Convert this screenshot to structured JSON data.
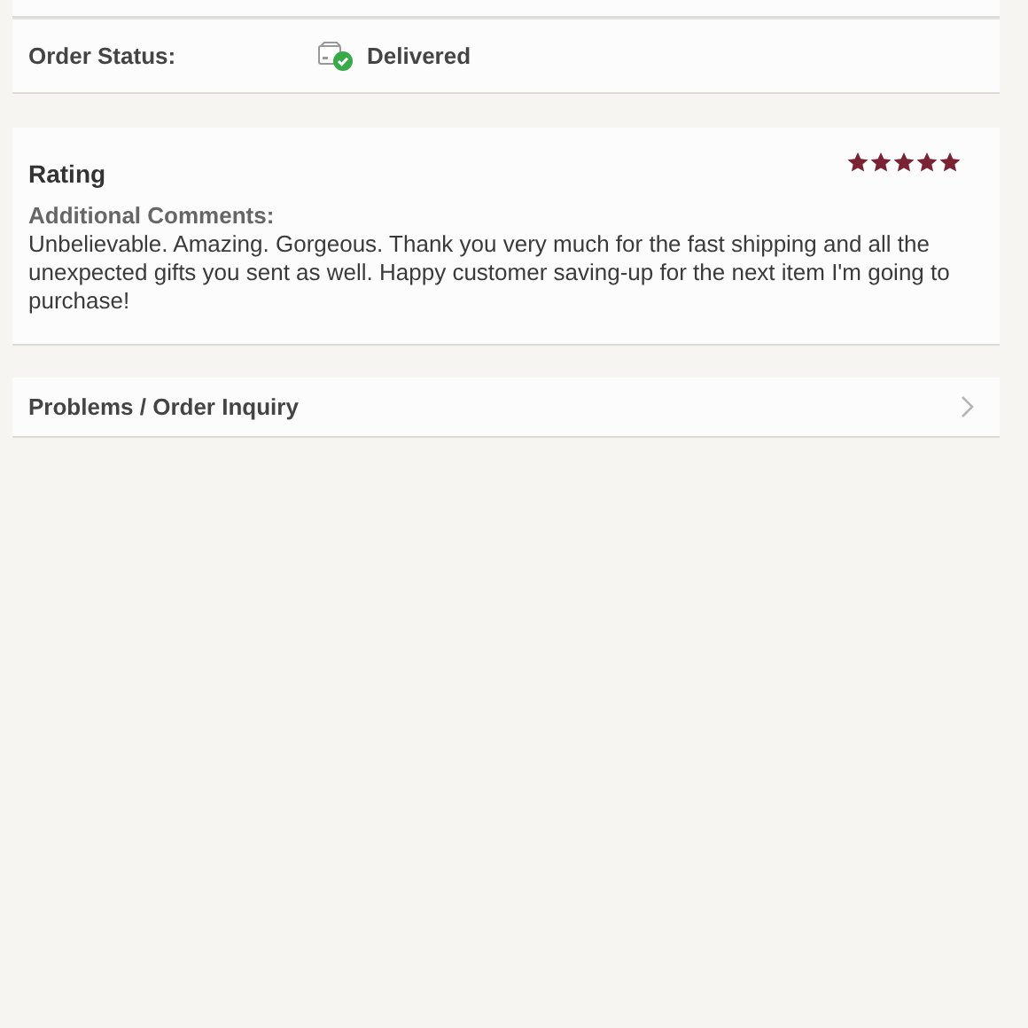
{
  "order_status": {
    "label": "Order Status:",
    "value": "Delivered"
  },
  "rating": {
    "title": "Rating",
    "stars": 5,
    "comments_label": "Additional Comments:",
    "comments": "Unbelievable. Amazing. Gorgeous. Thank you very much for the fast shipping and all the unexpected gifts you sent as well. Happy customer saving-up for the next item I'm going to purchase!"
  },
  "inquiry": {
    "label": "Problems / Order Inquiry"
  }
}
